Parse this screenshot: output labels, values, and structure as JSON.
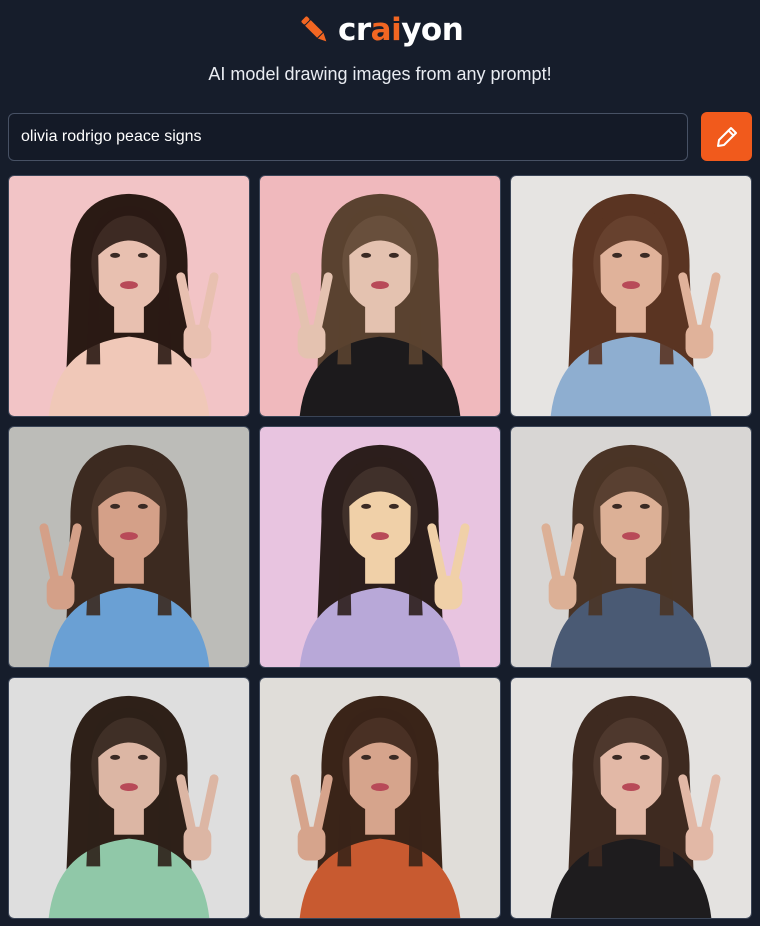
{
  "header": {
    "logo_parts": [
      "cr",
      "ai",
      "yon"
    ],
    "logo_icon": "pencil-icon",
    "tagline": "AI model drawing images from any prompt!"
  },
  "search": {
    "value": "olivia rodrigo peace signs",
    "button_icon": "pencil-icon"
  },
  "colors": {
    "background": "#161d2b",
    "accent": "#f15a1c"
  },
  "gallery": {
    "images": [
      {
        "alt": "Generated image 1",
        "bg": "#f2c4c6",
        "hair": "#2a1a14",
        "skin": "#e8c0b0",
        "shirt": "#f0c8b8"
      },
      {
        "alt": "Generated image 2",
        "bg": "#f0b9bd",
        "hair": "#5a4230",
        "skin": "#e4c2b0",
        "shirt": "#1c1a1c"
      },
      {
        "alt": "Generated image 3",
        "bg": "#e6e4e2",
        "hair": "#5a3422",
        "skin": "#e0b29a",
        "shirt": "#8eaed0"
      },
      {
        "alt": "Generated image 4",
        "bg": "#bcbcb8",
        "hair": "#3c2a20",
        "skin": "#d4a088",
        "shirt": "#6aa0d4"
      },
      {
        "alt": "Generated image 5",
        "bg": "#e8c4e0",
        "hair": "#2c1e1c",
        "skin": "#f0d0a8",
        "shirt": "#b8a8d8"
      },
      {
        "alt": "Generated image 6",
        "bg": "#d8d6d4",
        "hair": "#4a3426",
        "skin": "#dcb096",
        "shirt": "#4a5a74"
      },
      {
        "alt": "Generated image 7",
        "bg": "#dedede",
        "hair": "#2e2018",
        "skin": "#dcb6a4",
        "shirt": "#90c8a8"
      },
      {
        "alt": "Generated image 8",
        "bg": "#e0ddd9",
        "hair": "#3a2418",
        "skin": "#d6a48c",
        "shirt": "#c85a30"
      },
      {
        "alt": "Generated image 9",
        "bg": "#e4e2e0",
        "hair": "#3e2a20",
        "skin": "#e2b8a6",
        "shirt": "#1e1c1e"
      }
    ]
  }
}
